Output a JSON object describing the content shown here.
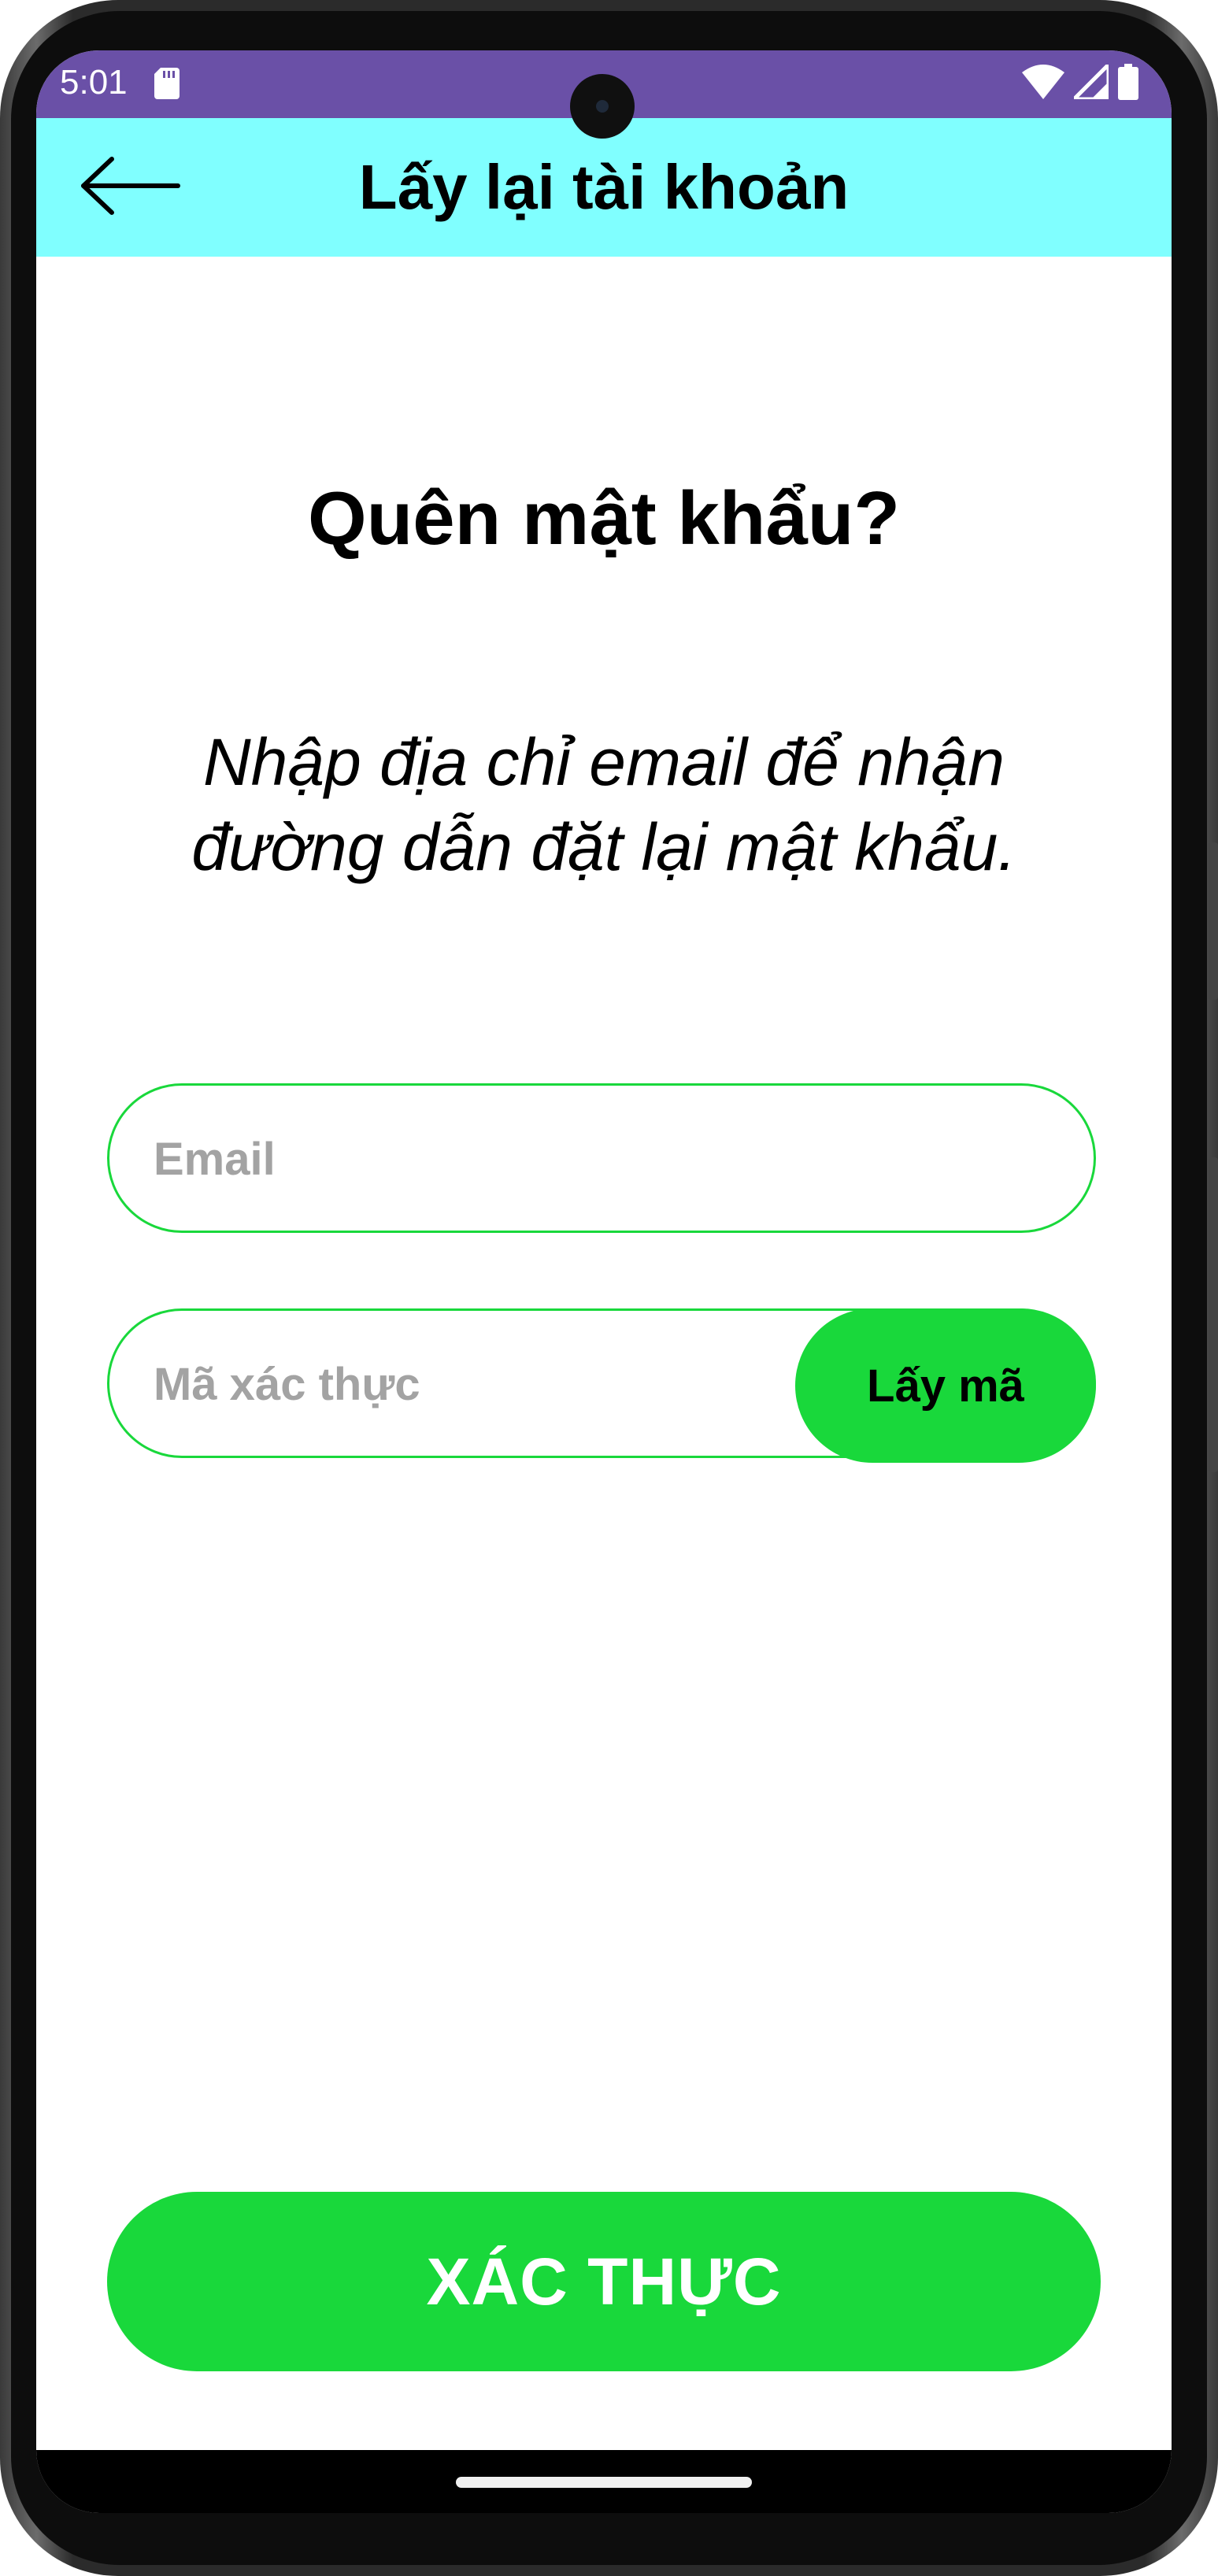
{
  "status_bar": {
    "time": "5:01",
    "background": "#6a50a7",
    "icons": [
      "sd-card-icon",
      "wifi-icon",
      "cell-signal-icon",
      "battery-icon"
    ]
  },
  "app_bar": {
    "title": "Lấy lại tài khoản",
    "background": "#80ffff",
    "back_icon": "arrow-left-icon"
  },
  "main": {
    "heading": "Quên mật khẩu?",
    "subtitle": "Nhập địa chỉ email để nhận đường dẫn đặt lại mật khẩu.",
    "email_field": {
      "placeholder": "Email",
      "value": ""
    },
    "code_field": {
      "placeholder": "Mã xác thực",
      "value": ""
    },
    "get_code_label": "Lấy mã",
    "submit_label": "XÁC THỰC"
  },
  "colors": {
    "accent": "#19d83b",
    "placeholder": "#a3a3a3"
  }
}
